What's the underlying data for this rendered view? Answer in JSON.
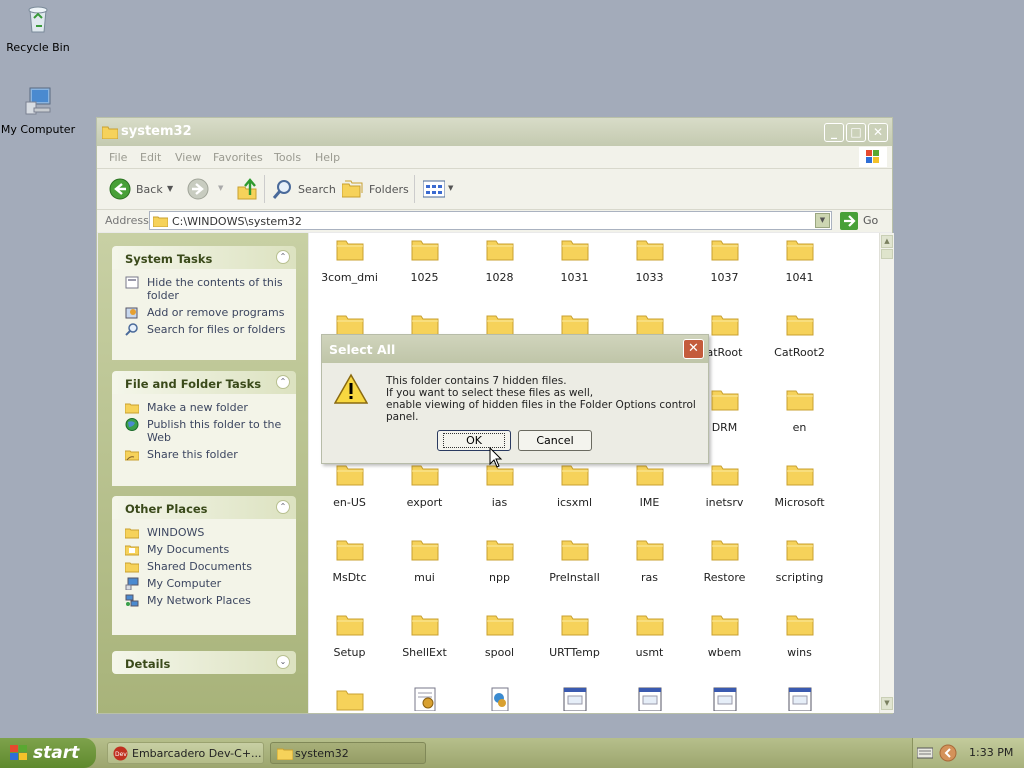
{
  "desktop": {
    "icons": [
      {
        "label": "Recycle Bin"
      },
      {
        "label": "My Computer"
      }
    ]
  },
  "window": {
    "title": "system32",
    "menu": [
      "File",
      "Edit",
      "View",
      "Favorites",
      "Tools",
      "Help"
    ],
    "toolbar": {
      "back": "Back",
      "search": "Search",
      "folders": "Folders"
    },
    "address": {
      "label": "Address",
      "value": "C:\\WINDOWS\\system32",
      "go": "Go"
    }
  },
  "left_pane": {
    "system_tasks": {
      "title": "System Tasks",
      "items": [
        "Hide the contents of this folder",
        "Add or remove programs",
        "Search for files or folders"
      ]
    },
    "file_folder_tasks": {
      "title": "File and Folder Tasks",
      "items": [
        "Make a new folder",
        "Publish this folder to the Web",
        "Share this folder"
      ]
    },
    "other_places": {
      "title": "Other Places",
      "items": [
        "WINDOWS",
        "My Documents",
        "Shared Documents",
        "My Computer",
        "My Network Places"
      ]
    },
    "details": {
      "title": "Details"
    }
  },
  "files": {
    "row1": [
      "3com_dmi",
      "1025",
      "1028",
      "1031",
      "1033",
      "1037",
      "1041"
    ],
    "row2_visible": [
      "atRoot",
      "CatRoot2"
    ],
    "row3_visible": [
      "DRM",
      "en"
    ],
    "row4": [
      "en-US",
      "export",
      "ias",
      "icsxml",
      "IME",
      "inetsrv",
      "Microsoft"
    ],
    "row5": [
      "MsDtc",
      "mui",
      "npp",
      "PreInstall",
      "ras",
      "Restore",
      "scripting"
    ],
    "row6": [
      "Setup",
      "ShellExt",
      "spool",
      "URTTemp",
      "usmt",
      "wbem",
      "wins"
    ]
  },
  "dialog": {
    "title": "Select All",
    "lines": [
      "This folder contains 7 hidden files.",
      "If you want to select these files as well,",
      "enable viewing of hidden files in the Folder Options control panel."
    ],
    "ok": "OK",
    "cancel": "Cancel"
  },
  "taskbar": {
    "start": "start",
    "tasks": [
      "Embarcadero Dev-C+...",
      "system32"
    ],
    "clock": "1:33 PM"
  },
  "colors": {
    "folder": "#f6d25a",
    "desktop": "#a3abba",
    "pane": "#b4bd88"
  }
}
